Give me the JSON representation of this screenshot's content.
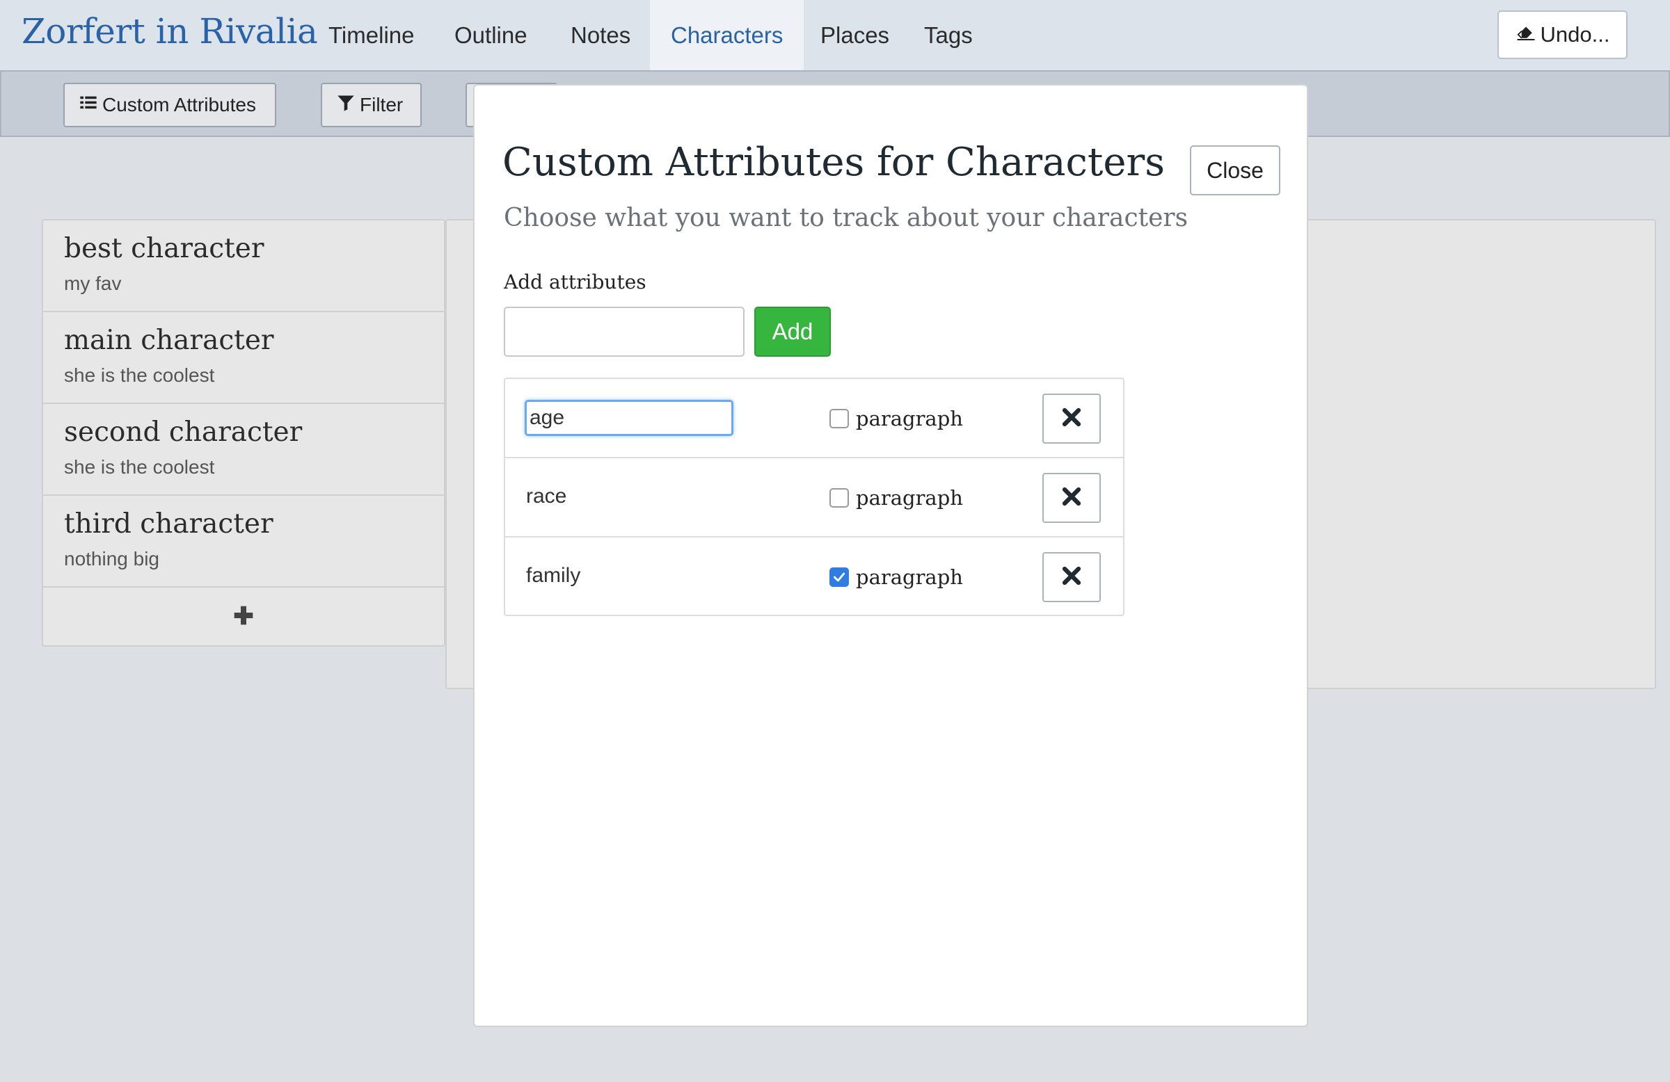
{
  "navbar": {
    "brand": "Zorfert in Rivalia",
    "tabs": [
      {
        "label": "Timeline",
        "active": false
      },
      {
        "label": "Outline",
        "active": false
      },
      {
        "label": "Notes",
        "active": false
      },
      {
        "label": "Characters",
        "active": true
      },
      {
        "label": "Places",
        "active": false
      },
      {
        "label": "Tags",
        "active": false
      }
    ],
    "undo_label": "Undo..."
  },
  "toolbar": {
    "custom_attributes_label": "Custom Attributes",
    "filter_label": "Filter"
  },
  "characters": [
    {
      "name": "best character",
      "description": "my fav"
    },
    {
      "name": "main character",
      "description": "she is the coolest"
    },
    {
      "name": "second character",
      "description": "she is the coolest"
    },
    {
      "name": "third character",
      "description": "nothing big"
    }
  ],
  "modal": {
    "title": "Custom Attributes for Characters",
    "subtitle": "Choose what you want to track about your characters",
    "close_label": "Close",
    "add_label": "Add attributes",
    "add_input_value": "",
    "add_button_label": "Add",
    "attributes": [
      {
        "name": "age",
        "paragraph": false,
        "editing": true
      },
      {
        "name": "race",
        "paragraph": false,
        "editing": false
      },
      {
        "name": "family",
        "paragraph": true,
        "editing": false
      }
    ],
    "paragraph_label": "paragraph"
  },
  "colors": {
    "brand": "#2a62a8",
    "add_button": "#37b63f",
    "checkbox_checked": "#2f7de0"
  },
  "icons": {
    "undo": "eraser-icon",
    "custom_attributes": "list-icon",
    "filter": "filter-icon",
    "add_character": "plus-icon",
    "remove": "close-icon",
    "checked": "checkmark-icon"
  }
}
